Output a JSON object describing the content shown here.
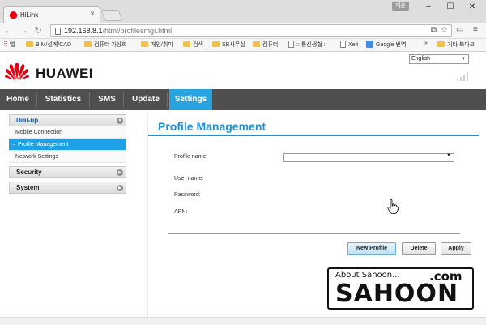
{
  "browser": {
    "tab_title": "HiLink",
    "user_badge": "재윤",
    "url_host": "192.168.8.1",
    "url_path": "/html/profilesmgr.html",
    "bookmarks": [
      {
        "label": "앱",
        "kind": "apps"
      },
      {
        "label": "BIM/설계/CAD",
        "kind": "folder"
      },
      {
        "label": "컴퓨터 가상화",
        "kind": "folder"
      },
      {
        "label": "개인/취미",
        "kind": "folder"
      },
      {
        "label": "검색",
        "kind": "folder"
      },
      {
        "label": "SB사무실",
        "kind": "folder"
      },
      {
        "label": "컴퓨터",
        "kind": "folder"
      },
      {
        "label": ":: 통신생협 ::",
        "kind": "doc"
      },
      {
        "label": "Xeit",
        "kind": "doc"
      },
      {
        "label": "Google 번역",
        "kind": "translate"
      },
      {
        "label": "»",
        "kind": "more"
      },
      {
        "label": "기타 북마크",
        "kind": "folder"
      }
    ]
  },
  "header": {
    "brand": "HUAWEI",
    "language": "English",
    "brand_color": "#e60012"
  },
  "nav": {
    "items": [
      "Home",
      "Statistics",
      "SMS",
      "Update",
      "Settings"
    ],
    "active": "Settings",
    "active_color": "#27a3e0"
  },
  "sidebar": {
    "dialup": "Dial-up",
    "mobile_connection": "Mobile Connection",
    "profile_management": "Profile Management",
    "network_settings": "Network Settings",
    "security": "Security",
    "system": "System"
  },
  "main": {
    "title": "Profile Management",
    "profile_name_label": "Profile name:",
    "profile_name_value": "",
    "username_label": "User name:",
    "password_label": "Password:",
    "apn_label": "APN:",
    "new_profile_button": "New Profile",
    "delete_button": "Delete",
    "apply_button": "Apply"
  },
  "watermark": {
    "line1": "About Sahoon...",
    "com": ".com",
    "big": "SAHOON"
  }
}
